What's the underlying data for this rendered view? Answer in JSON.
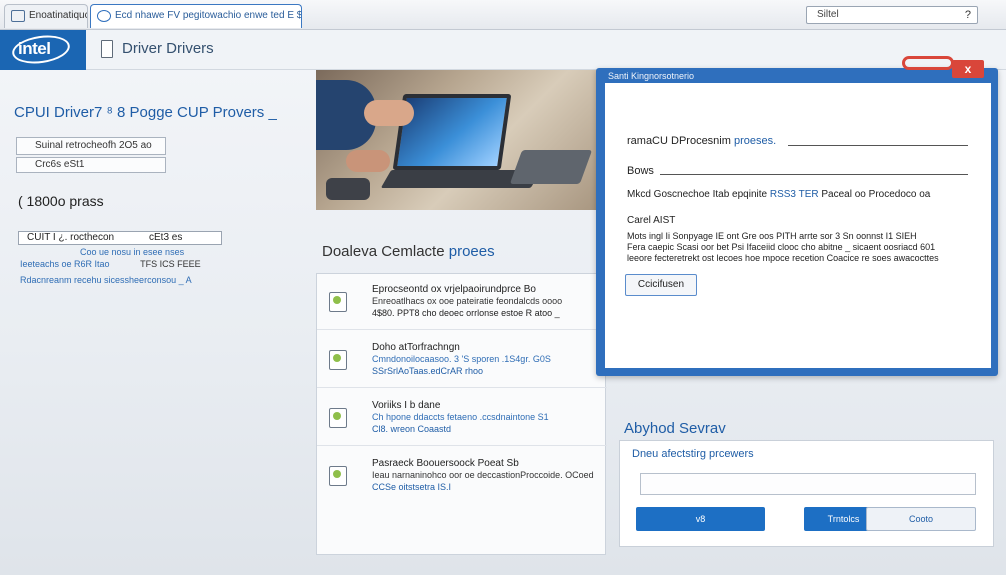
{
  "browser": {
    "tabs": [
      {
        "label": "Enoatinatiqucal"
      },
      {
        "label": "Ecd nhawe FV pegitowachio enwe ted E $D"
      }
    ],
    "search": {
      "value": "Siltel",
      "icon": "?"
    }
  },
  "header": {
    "logo": "intel",
    "title": "Driver Drivers"
  },
  "left": {
    "title": "CPUI Driver7 ⁸ 8 Pogge CUP Provers _",
    "field1": "Suinal retrocheofh 2O5 ao",
    "field2": "Crc6s eSt1",
    "price": "( 1800o prass",
    "box_label": "CUIT I ¿. rocthecon",
    "box_values": "cEt3 es",
    "links": [
      {
        "text": "Coo ue nosu in esee nses",
        "suffix": ""
      },
      {
        "text": "Ieeteachs oe R6R Itao",
        "suffix": "TFS   ICS FEEE"
      },
      {
        "text": "Rdacnreanm recehu sicessheerconsou _ A",
        "suffix": ""
      }
    ]
  },
  "hero": {
    "alt": "person using laptop"
  },
  "section": {
    "heading_prefix": "Doaleva Cemlacte ",
    "heading_accent": "proees"
  },
  "drivers": [
    {
      "title": "Eprocseontd ox vrjelpaoirundprce Bo",
      "desc": "Enreoatlhacs ox ooe pateiratie feondalcds oooo",
      "meta": "4$80. PPT8 cho deoec orrlonse estoe R atoo _"
    },
    {
      "title": "Doho atTorfrachngn",
      "desc": "Cmndonoilocaasoo. 3 'S sporen .1S4gr. G0S",
      "meta": "SSrSrlAoTaas.edCrAR rhoo"
    },
    {
      "title": "Voriiks I b dane",
      "desc": "Ch hpone ddaccts fetaeno .ccsdnaintone   S1",
      "meta": "Cl8. wreon Coaastd"
    },
    {
      "title": "Pasraeck Boouersoock Poeat Sb",
      "desc": "Ieau narnaninohco oor oe deccastionProccoide. OCoed",
      "meta": "CCSe oitstsetra IS.I"
    }
  ],
  "dialog": {
    "title": "Santi Kingnorsotnerio",
    "close": "x",
    "row1_prefix": "ramaCU DProcesnim ",
    "row1_accent": "proeses.",
    "row2": "Bows",
    "row3_prefix": "Mkcd Goscnechoe Itab epqinite ",
    "row3_accent": "RSS3 TER",
    "row3_suffix": " Paceal oo Procedoco oa",
    "row4": "Carel AIST",
    "para": [
      "Mots ingl Ii Sonpyage IE ont Gre oos PITH arrte sor 3 Sn oonnst I1 SIEH",
      "Fera caepic Scasi oor bet Psi Ifaceiid clooc cho abitne _ sicaent oosriacd 601",
      "leeore fecteretrekt ost lecoes hoe mpoce recetion Coacice re soes awacocttes"
    ],
    "button": "Ccicifusen"
  },
  "bottom_panel": {
    "heading": "Abyhod Sevrav",
    "title": "Dneu afectstirg prcewers",
    "input_value": "",
    "btn1": "v8",
    "btn2": "Trntolcs",
    "btn3": "Cooto"
  }
}
